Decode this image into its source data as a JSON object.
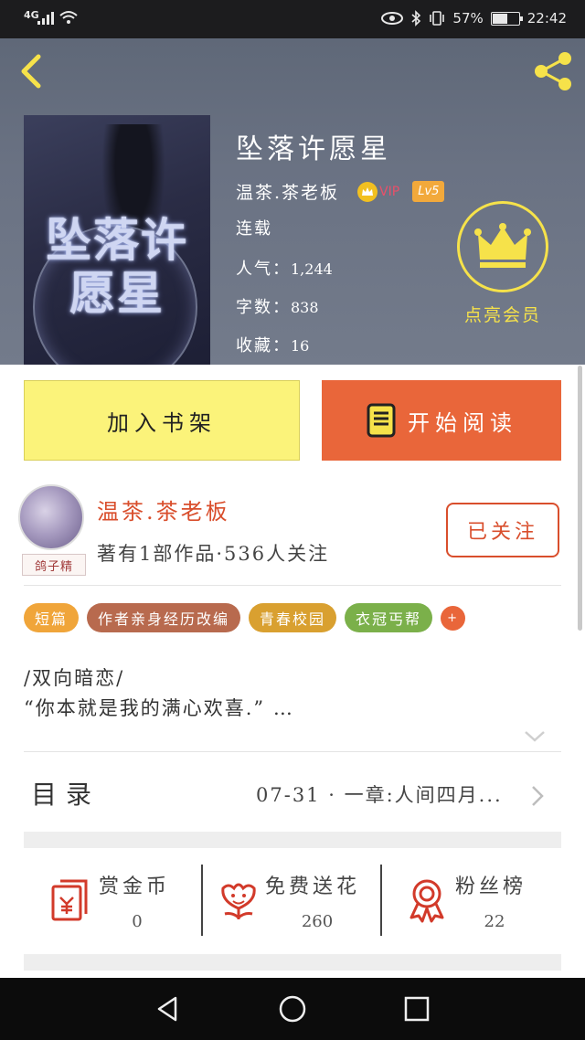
{
  "status_bar": {
    "network": "4G",
    "battery": "57%",
    "battery_level": 0.57,
    "time": "22:42"
  },
  "book": {
    "title": "坠落许愿星",
    "cover_title": "坠落许愿星",
    "author": "温茶.茶老板",
    "vip_label": "VIP",
    "level": "Lv5",
    "status": "连载",
    "popularity_label": "人气：",
    "popularity": "1,244",
    "words_label": "字数：",
    "words": "838",
    "favorites_label": "收藏：",
    "favorites": "16"
  },
  "member": {
    "label": "点亮会员"
  },
  "actions": {
    "add_shelf": "加入书架",
    "start_read": "开始阅读"
  },
  "author_card": {
    "name": "温茶.茶老板",
    "tag": "鸽子精",
    "subtitle": "著有1部作品·536人关注",
    "follow_label": "已关注"
  },
  "tags": [
    {
      "label": "短篇",
      "color": "#f0a53a"
    },
    {
      "label": "作者亲身经历改编",
      "color": "#b86a4e"
    },
    {
      "label": "青春校园",
      "color": "#d9a030"
    },
    {
      "label": "衣冠丐帮",
      "color": "#7bb04a"
    }
  ],
  "tag_more": "+",
  "summary": {
    "line1": "/双向暗恋/",
    "line2": "“你本就是我的满心欢喜.” …"
  },
  "toc": {
    "label": "目录",
    "latest": "07-31 · 一章:人间四月..."
  },
  "stats": [
    {
      "label": "赏金币",
      "value": "0",
      "icon": "red-envelope-icon"
    },
    {
      "label": "免费送花",
      "value": "260",
      "icon": "flower-icon"
    },
    {
      "label": "粉丝榜",
      "value": "22",
      "icon": "medal-icon"
    }
  ],
  "colors": {
    "accent_orange": "#e9663a",
    "accent_red": "#d94e2c",
    "shelf_yellow": "#fbf37a",
    "crown_yellow": "#f6e24a"
  }
}
